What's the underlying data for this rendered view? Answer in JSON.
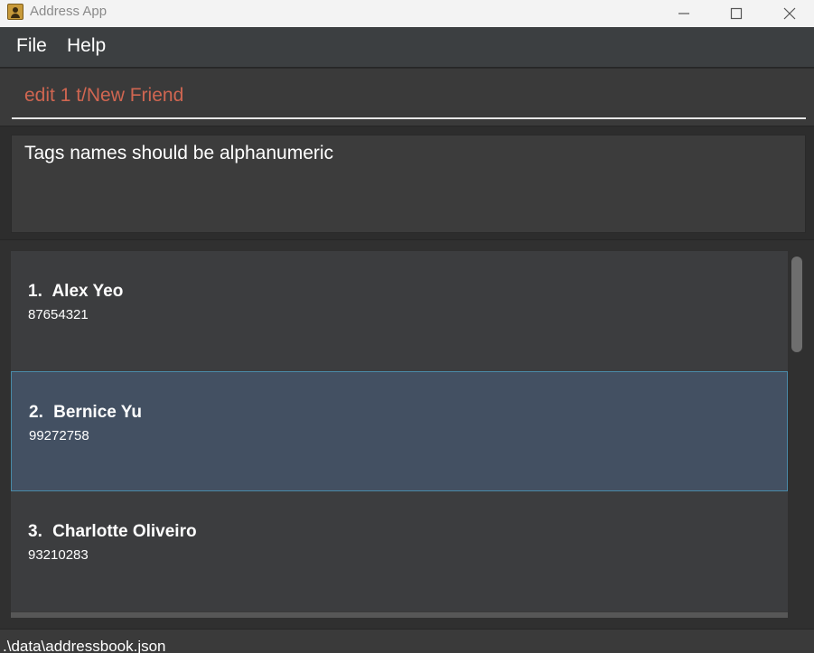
{
  "window": {
    "title": "Address App",
    "app_icon": "address-book-icon"
  },
  "menu": {
    "file": "File",
    "help": "Help"
  },
  "command": {
    "value": "edit 1 t/New Friend",
    "error_color": "#d06651"
  },
  "result": {
    "message": "Tags names should be alphanumeric"
  },
  "persons": [
    {
      "index": "1.",
      "name": "Alex Yeo",
      "phone": "87654321",
      "selected": false
    },
    {
      "index": "2.",
      "name": "Bernice Yu",
      "phone": "99272758",
      "selected": true
    },
    {
      "index": "3.",
      "name": "Charlotte Oliveiro",
      "phone": "93210283",
      "selected": false
    }
  ],
  "status": {
    "file_path": ".\\data\\addressbook.json"
  },
  "colors": {
    "selected_card": "#435062",
    "selected_border": "#4a8aa8"
  }
}
